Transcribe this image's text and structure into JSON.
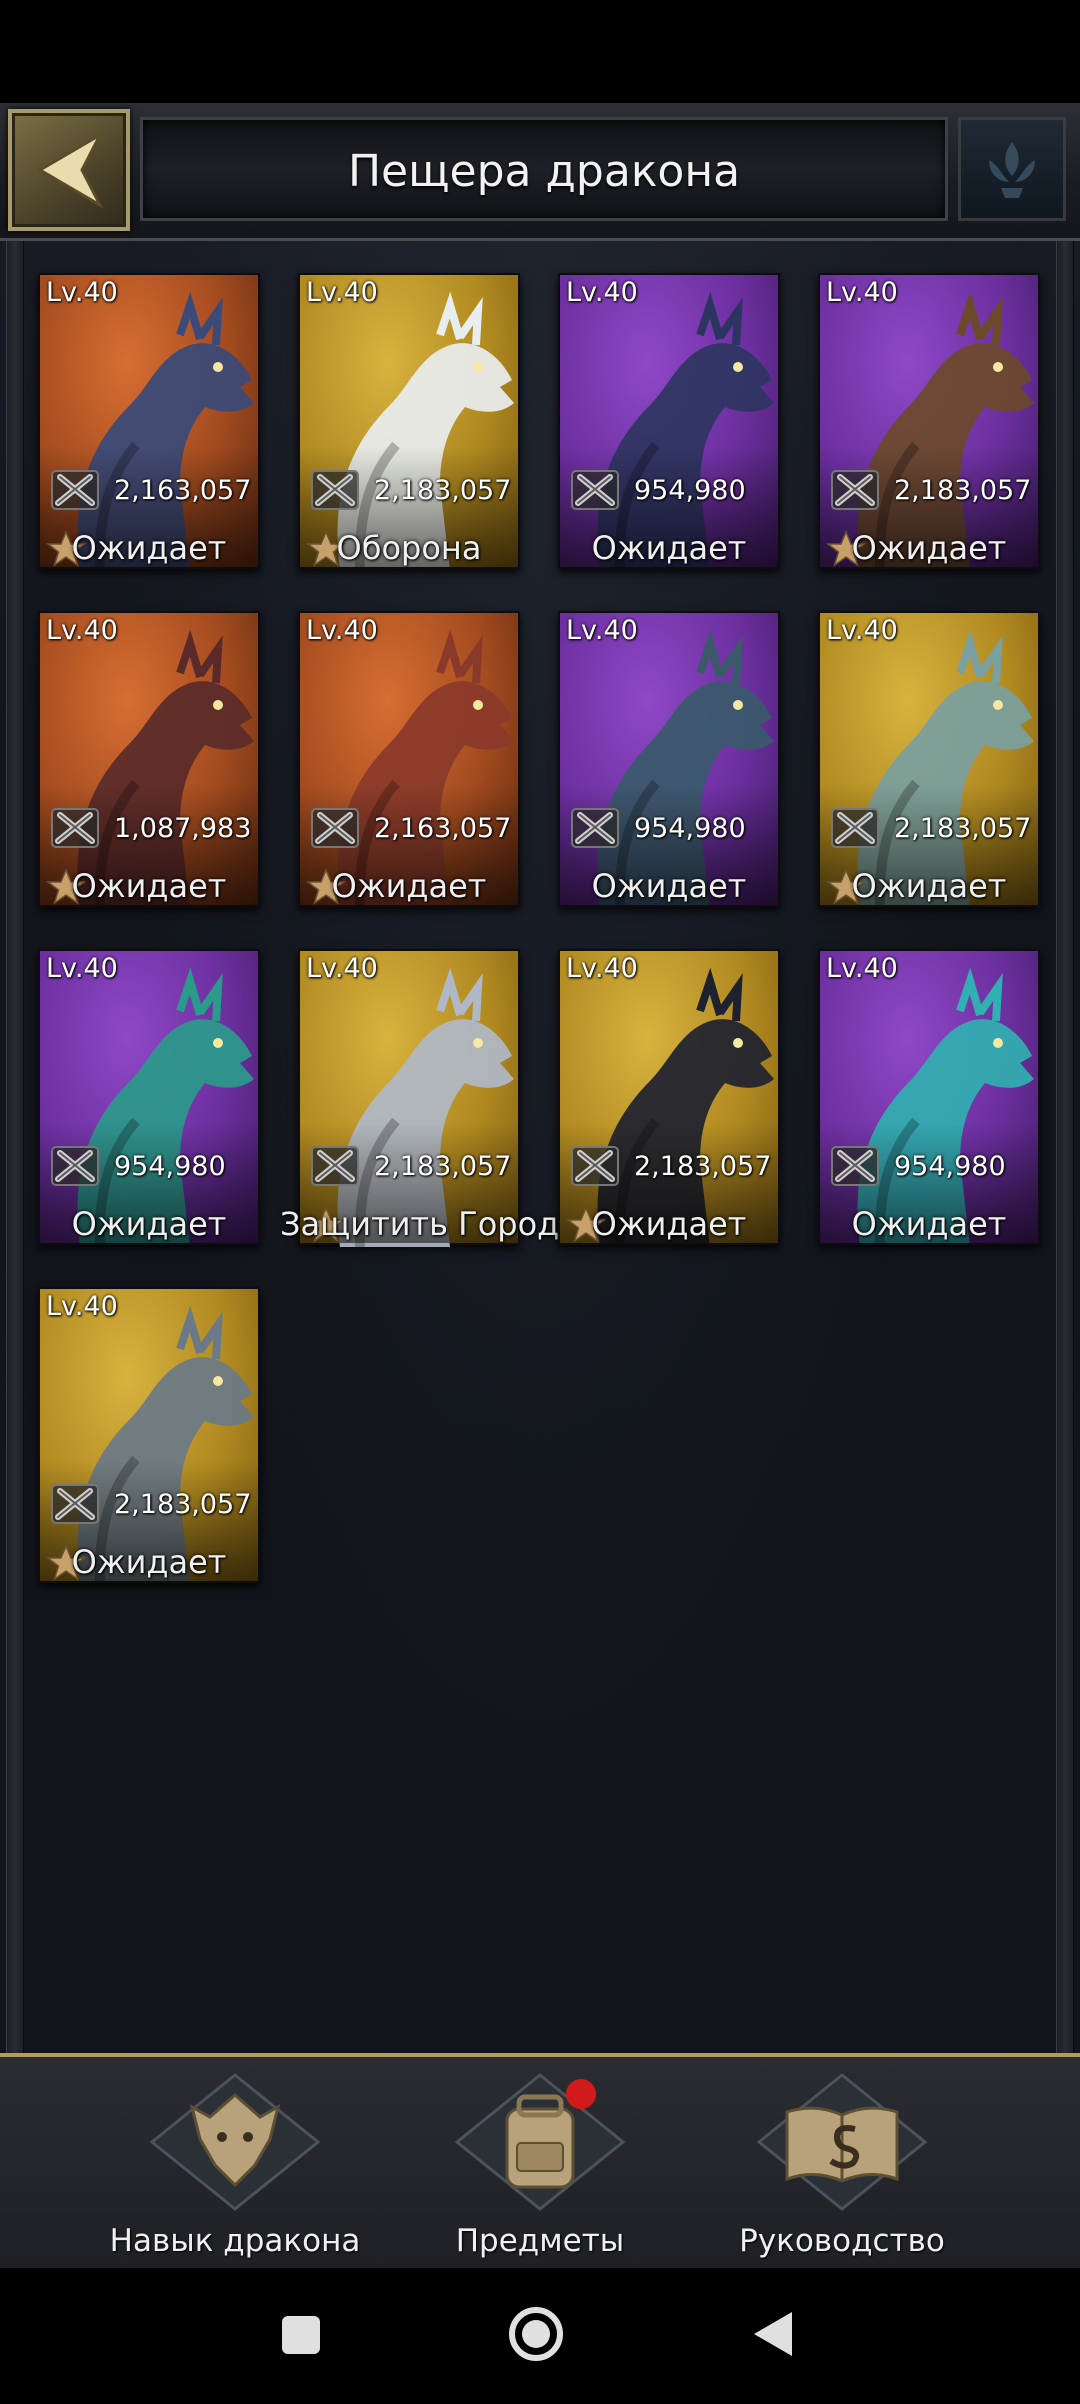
{
  "header": {
    "title": "Пещера дракона"
  },
  "dragons": [
    {
      "level": "Lv.40",
      "power": "2,163,057",
      "status": "Ожидает",
      "bg": "orange",
      "starred": true
    },
    {
      "level": "Lv.40",
      "power": "2,183,057",
      "status": "Оборона",
      "bg": "gold",
      "starred": true
    },
    {
      "level": "Lv.40",
      "power": "954,980",
      "status": "Ожидает",
      "bg": "purple",
      "starred": false
    },
    {
      "level": "Lv.40",
      "power": "2,183,057",
      "status": "Ожидает",
      "bg": "purple",
      "starred": true
    },
    {
      "level": "Lv.40",
      "power": "1,087,983",
      "status": "Ожидает",
      "bg": "orange",
      "starred": true
    },
    {
      "level": "Lv.40",
      "power": "2,163,057",
      "status": "Ожидает",
      "bg": "orange",
      "starred": true
    },
    {
      "level": "Lv.40",
      "power": "954,980",
      "status": "Ожидает",
      "bg": "purple",
      "starred": false
    },
    {
      "level": "Lv.40",
      "power": "2,183,057",
      "status": "Ожидает",
      "bg": "gold",
      "starred": true
    },
    {
      "level": "Lv.40",
      "power": "954,980",
      "status": "Ожидает",
      "bg": "purple",
      "starred": false
    },
    {
      "level": "Lv.40",
      "power": "2,183,057",
      "status": "Защитить Город",
      "bg": "gold",
      "starred": true
    },
    {
      "level": "Lv.40",
      "power": "2,183,057",
      "status": "Ожидает",
      "bg": "gold",
      "starred": true
    },
    {
      "level": "Lv.40",
      "power": "954,980",
      "status": "Ожидает",
      "bg": "purple",
      "starred": false
    },
    {
      "level": "Lv.40",
      "power": "2,183,057",
      "status": "Ожидает",
      "bg": "gold",
      "starred": true
    }
  ],
  "bottom_nav": {
    "skill_label": "Навык дракона",
    "items_label": "Предметы",
    "guide_label": "Руководство"
  },
  "colors": {
    "gold": "#c9a030",
    "purple": "#7a3bb0",
    "orange": "#b8572a",
    "nav_border": "#b59a5c",
    "badge": "#d31a1a"
  }
}
